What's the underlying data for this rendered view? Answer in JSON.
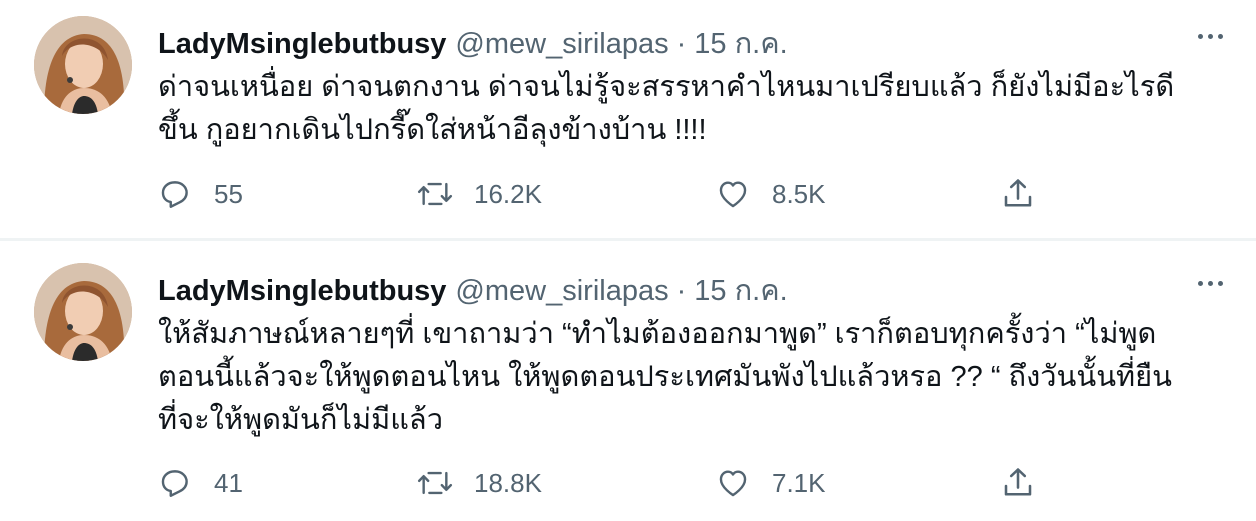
{
  "tweets": [
    {
      "display_name": "LadyMsinglebutbusy",
      "handle": "@mew_sirilapas",
      "separator": "·",
      "date": "15 ก.ค.",
      "text": "ด่าจนเหนื่อย ด่าจนตกงาน ด่าจนไม่รู้จะสรรหาคำไหนมาเปรียบแล้ว ก็ยังไม่มีอะไรดี\nขึ้น กูอยากเดินไปกรี๊ดใส่หน้าอีลุงข้างบ้าน !!!!",
      "replies": "55",
      "retweets": "16.2K",
      "likes": "8.5K"
    },
    {
      "display_name": "LadyMsinglebutbusy",
      "handle": "@mew_sirilapas",
      "separator": "·",
      "date": "15 ก.ค.",
      "text": "ให้สัมภาษณ์หลายๆที่ เขาถามว่า “ทำไมต้องออกมาพูด” เราก็ตอบทุกครั้งว่า “ไม่พูด\nตอนนี้แล้วจะให้พูดตอนไหน ให้พูดตอนประเทศมันพังไปแล้วหรอ ?? “ ถึงวันนั้นที่ยืน\nที่จะให้พูดมันก็ไม่มีแล้ว",
      "replies": "41",
      "retweets": "18.8K",
      "likes": "7.1K"
    }
  ],
  "icons": {
    "reply": "reply-icon",
    "retweet": "retweet-icon",
    "like": "heart-icon",
    "share": "share-icon",
    "more": "more-icon"
  },
  "colors": {
    "text_primary": "#0f1419",
    "text_secondary": "#536471",
    "divider": "#eff3f4"
  }
}
